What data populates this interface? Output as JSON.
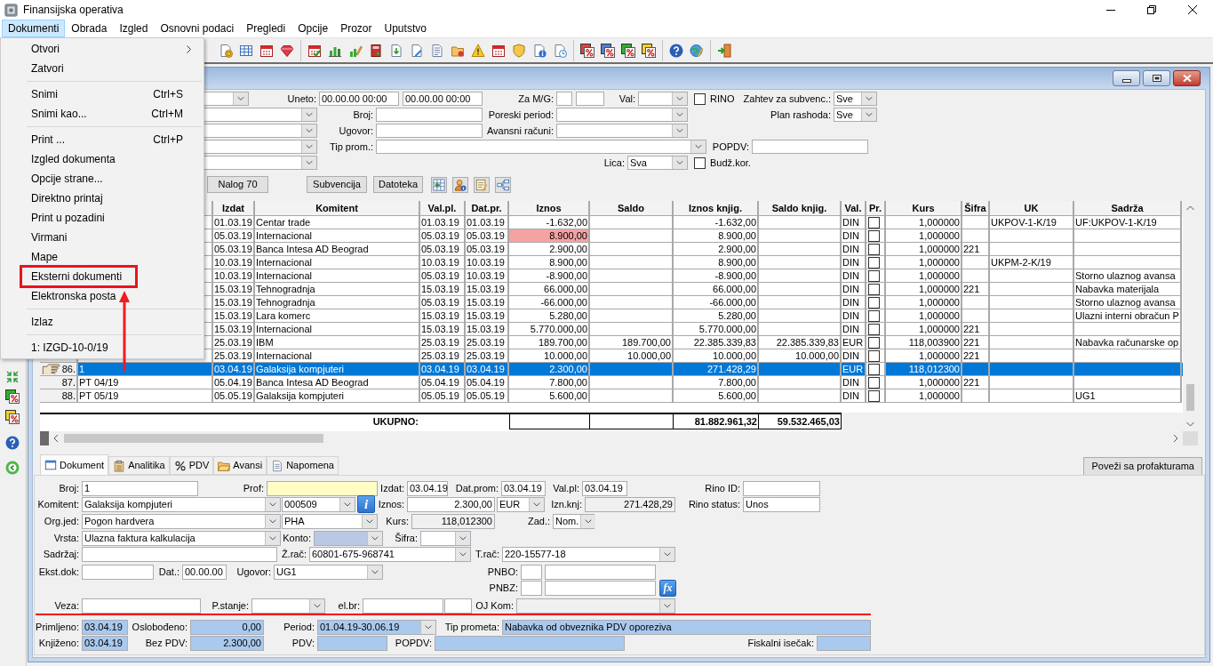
{
  "window": {
    "title": "Finansijska operativa"
  },
  "menu_bar": [
    {
      "label": "Dokumenti",
      "selected": true
    },
    {
      "label": "Obrada",
      "selected": false
    },
    {
      "label": "Izgled",
      "selected": false
    },
    {
      "label": "Osnovni podaci",
      "selected": false
    },
    {
      "label": "Pregledi",
      "selected": false
    },
    {
      "label": "Opcije",
      "selected": false
    },
    {
      "label": "Prozor",
      "selected": false
    },
    {
      "label": "Uputstvo",
      "selected": false
    }
  ],
  "open_menu": [
    {
      "kind": "item",
      "label": "Otvori",
      "submenu": true,
      "callout": false
    },
    {
      "kind": "item",
      "label": "Zatvori",
      "submenu": false,
      "callout": false
    },
    {
      "kind": "separator"
    },
    {
      "kind": "item",
      "label": "Snimi",
      "shortcut": "Ctrl+S",
      "submenu": false,
      "callout": false
    },
    {
      "kind": "item",
      "label": "Snimi kao...",
      "shortcut": "Ctrl+M",
      "submenu": false,
      "callout": false
    },
    {
      "kind": "separator"
    },
    {
      "kind": "item",
      "label": "Print ...",
      "shortcut": "Ctrl+P",
      "submenu": false,
      "callout": false
    },
    {
      "kind": "item",
      "label": "Izgled dokumenta",
      "submenu": false,
      "callout": false
    },
    {
      "kind": "item",
      "label": "Opcije strane...",
      "submenu": false,
      "callout": false
    },
    {
      "kind": "item",
      "label": "Direktno printaj",
      "submenu": false,
      "callout": false
    },
    {
      "kind": "item",
      "label": "Print u pozadini",
      "submenu": false,
      "callout": false
    },
    {
      "kind": "item",
      "label": "Virmani",
      "submenu": false,
      "callout": false
    },
    {
      "kind": "item",
      "label": "Mape",
      "submenu": false,
      "callout": false
    },
    {
      "kind": "item",
      "label": "Eksterni dokumenti",
      "submenu": false,
      "callout": true
    },
    {
      "kind": "item",
      "label": "Elektronska posta",
      "submenu": false,
      "callout": false
    },
    {
      "kind": "separator"
    },
    {
      "kind": "item",
      "label": "Izlaz",
      "submenu": false,
      "callout": false
    },
    {
      "kind": "separator"
    },
    {
      "kind": "item",
      "label": "1: IZGD-10-0/19",
      "submenu": false,
      "callout": false
    }
  ],
  "filters": {
    "lines": [
      {
        "fields": [
          {
            "kind": "combo"
          },
          {
            "kind": "text",
            "label": "Uneto:",
            "value": "00.00.00 00:00"
          },
          {
            "kind": "text",
            "value": "00.00.00 00:00"
          },
          {
            "kind": "text",
            "label": "Za M/G:"
          },
          {
            "kind": "text"
          },
          {
            "kind": "combo",
            "label": "Val:"
          },
          {
            "kind": "check",
            "label": "RINO",
            "checked": false
          },
          {
            "kind": "combo",
            "label": "Zahtev za subvenc.:",
            "value": "Sve"
          }
        ]
      },
      {
        "fields": [
          {
            "kind": "combo"
          },
          {
            "kind": "text",
            "label": "Broj:"
          },
          {
            "kind": "combo",
            "label": "Poreski period:"
          },
          {
            "kind": "combo",
            "label": "Plan rashoda:",
            "value": "Sve"
          }
        ]
      },
      {
        "fields": [
          {
            "kind": "combo"
          },
          {
            "kind": "text",
            "label": "Ugovor:"
          },
          {
            "kind": "combo",
            "label": "Avansni računi:"
          }
        ]
      },
      {
        "fields": [
          {
            "kind": "combo"
          },
          {
            "kind": "combo",
            "label": "Tip prom.:"
          },
          {
            "kind": "text",
            "label": "POPDV:"
          }
        ]
      },
      {
        "fields": [
          {
            "kind": "combo"
          },
          {
            "kind": "combo",
            "label": "Lica:",
            "value": "Sva"
          },
          {
            "kind": "check",
            "label": "Budž.kor.",
            "checked": false
          }
        ]
      }
    ],
    "buttons": [
      "Nalog 70",
      "Subvencija",
      "Datoteka"
    ]
  },
  "table": {
    "columns": {
      "izdat": "Izdat",
      "komitent": "Komitent",
      "val_pl": "Val.pl.",
      "dat_pr": "Dat.pr.",
      "iznos": "Iznos",
      "saldo": "Saldo",
      "iznos_knjig": "Iznos knjig.",
      "saldo_knjig": "Saldo knjig.",
      "val": "Val.",
      "pr": "Pr.",
      "kurs": "Kurs",
      "sifra": "Šifra",
      "uk": "UK",
      "sadrzaj": "Sadrža"
    },
    "rows": [
      {
        "selected": false,
        "izdat": "01.03.19",
        "komitent": "Centar trade",
        "val_pl": "01.03.19",
        "dat_pr": "01.03.19",
        "iznos": "-1.632,00",
        "iznos_alert": false,
        "iznos_knjig": "-1.632,00",
        "val": "DIN",
        "pr_checked": false,
        "kurs": "1,000000",
        "uk": "UKPOV-1-K/19",
        "sadrzaj": "UF:UKPOV-1-K/19"
      },
      {
        "selected": false,
        "izdat": "05.03.19",
        "komitent": "Internacional",
        "val_pl": "05.03.19",
        "dat_pr": "05.03.19",
        "iznos": "8.900,00",
        "iznos_alert": true,
        "iznos_knjig": "8.900,00",
        "val": "DIN",
        "pr_checked": false,
        "kurs": "1,000000"
      },
      {
        "selected": false,
        "izdat": "05.03.19",
        "komitent": "Banca Intesa AD Beograd",
        "val_pl": "05.03.19",
        "dat_pr": "05.03.19",
        "iznos": "2.900,00",
        "iznos_alert": false,
        "iznos_knjig": "2.900,00",
        "val": "DIN",
        "pr_checked": false,
        "kurs": "1,000000",
        "sifra": "221"
      },
      {
        "selected": false,
        "izdat": "10.03.19",
        "komitent": "Internacional",
        "val_pl": "10.03.19",
        "dat_pr": "10.03.19",
        "iznos": "8.900,00",
        "iznos_alert": false,
        "iznos_knjig": "8.900,00",
        "val": "DIN",
        "pr_checked": false,
        "kurs": "1,000000",
        "uk": "UKPM-2-K/19"
      },
      {
        "selected": false,
        "izdat": "10.03.19",
        "komitent": "Internacional",
        "val_pl": "05.03.19",
        "dat_pr": "10.03.19",
        "iznos": "-8.900,00",
        "iznos_alert": false,
        "iznos_knjig": "-8.900,00",
        "val": "DIN",
        "pr_checked": false,
        "kurs": "1,000000",
        "sadrzaj": "Storno ulaznog avansa"
      },
      {
        "selected": false,
        "izdat": "15.03.19",
        "komitent": "Tehnogradnja",
        "val_pl": "15.03.19",
        "dat_pr": "15.03.19",
        "iznos": "66.000,00",
        "iznos_alert": false,
        "iznos_knjig": "66.000,00",
        "val": "DIN",
        "pr_checked": false,
        "kurs": "1,000000",
        "sifra": "221",
        "sadrzaj": "Nabavka materijala"
      },
      {
        "selected": false,
        "izdat": "15.03.19",
        "komitent": "Tehnogradnja",
        "val_pl": "05.03.19",
        "dat_pr": "15.03.19",
        "iznos": "-66.000,00",
        "iznos_alert": false,
        "iznos_knjig": "-66.000,00",
        "val": "DIN",
        "pr_checked": false,
        "kurs": "1,000000",
        "sadrzaj": "Storno ulaznog avansa"
      },
      {
        "selected": false,
        "izdat": "15.03.19",
        "komitent": "Lara komerc",
        "val_pl": "15.03.19",
        "dat_pr": "15.03.19",
        "iznos": "5.280,00",
        "iznos_alert": false,
        "iznos_knjig": "5.280,00",
        "val": "DIN",
        "pr_checked": false,
        "kurs": "1,000000",
        "sadrzaj": "Ulazni interni obračun P"
      },
      {
        "selected": false,
        "izdat": "15.03.19",
        "komitent": "Internacional",
        "val_pl": "15.03.19",
        "dat_pr": "15.03.19",
        "iznos": "5.770.000,00",
        "iznos_alert": false,
        "iznos_knjig": "5.770.000,00",
        "val": "DIN",
        "pr_checked": false,
        "kurs": "1,000000",
        "sifra": "221"
      },
      {
        "selected": false,
        "izdat": "25.03.19",
        "komitent": "IBM",
        "val_pl": "25.03.19",
        "dat_pr": "25.03.19",
        "iznos": "189.700,00",
        "iznos_alert": false,
        "saldo": "189.700,00",
        "iznos_knjig": "22.385.339,83",
        "saldo_knjig": "22.385.339,83",
        "val": "EUR",
        "pr_checked": false,
        "kurs": "118,003900",
        "sifra": "221",
        "sadrzaj": "Nabavka računarske op"
      },
      {
        "selected": false,
        "izdat": "25.03.19",
        "komitent": "Internacional",
        "val_pl": "25.03.19",
        "dat_pr": "25.03.19",
        "iznos": "10.000,00",
        "iznos_alert": false,
        "saldo": "10.000,00",
        "iznos_knjig": "10.000,00",
        "saldo_knjig": "10.000,00",
        "val": "DIN",
        "pr_checked": false,
        "kurs": "1,000000",
        "sifra": "221"
      },
      {
        "selected": true,
        "num": "86.",
        "broj": "1",
        "izdat": "03.04.19",
        "komitent": "Galaksija kompjuteri",
        "val_pl": "03.04.19",
        "dat_pr": "03.04.19",
        "iznos": "2.300,00",
        "iznos_alert": false,
        "iznos_knjig": "271.428,29",
        "val": "EUR",
        "pr_checked": false,
        "kurs": "118,012300"
      },
      {
        "selected": false,
        "num": "87.",
        "broj": "PT 04/19",
        "izdat": "05.04.19",
        "komitent": "Banca Intesa AD Beograd",
        "val_pl": "05.04.19",
        "dat_pr": "05.04.19",
        "iznos": "7.800,00",
        "iznos_alert": false,
        "iznos_knjig": "7.800,00",
        "val": "DIN",
        "pr_checked": false,
        "kurs": "1,000000",
        "sifra": "221"
      },
      {
        "selected": false,
        "num": "88.",
        "broj": "PT 05/19",
        "izdat": "05.05.19",
        "komitent": "Galaksija kompjuteri",
        "val_pl": "05.05.19",
        "dat_pr": "05.05.19",
        "iznos": "5.600,00",
        "iznos_alert": false,
        "iznos_knjig": "5.600,00",
        "val": "DIN",
        "pr_checked": false,
        "kurs": "1,000000",
        "sadrzaj": "UG1"
      }
    ],
    "totals": {
      "label": "UKUPNO:",
      "iznos_knjig": "81.882.961,32",
      "saldo_knjig": "59.532.465,03"
    }
  },
  "detail_tabs": [
    {
      "label": "Dokument",
      "selected": true
    },
    {
      "label": "Analitika",
      "selected": false
    },
    {
      "label": "PDV",
      "selected": false
    },
    {
      "label": "Avansi",
      "selected": false
    },
    {
      "label": "Napomena",
      "selected": false
    }
  ],
  "link_button": "Poveži sa profakturama",
  "form": {
    "lines": [
      {
        "fields": [
          {
            "kind": "text",
            "label": "Broj:",
            "value": "1"
          },
          {
            "kind": "text",
            "label": "Prof:",
            "color": "#fffdc5"
          },
          {
            "kind": "text",
            "label": "Izdat:",
            "value": "03.04.19"
          },
          {
            "kind": "text",
            "label": "Dat.prom:",
            "value": "03.04.19"
          },
          {
            "kind": "text",
            "label": "Val.pl:",
            "value": "03.04.19"
          },
          {
            "kind": "text",
            "label": "Rino ID:"
          }
        ]
      },
      {
        "fields": [
          {
            "kind": "combo",
            "label": "Komitent:",
            "value": "Galaksija kompjuteri"
          },
          {
            "kind": "combo",
            "value": "000509"
          },
          {
            "kind": "info-button",
            "value": "i"
          },
          {
            "kind": "number",
            "label": "Iznos:",
            "value": "2.300,00"
          },
          {
            "kind": "combo",
            "value": "EUR"
          },
          {
            "kind": "number",
            "label": "Izn.knj:",
            "value": "271.428,29",
            "color": "#f0f0f0"
          },
          {
            "kind": "text",
            "label": "Rino status:",
            "value": "Unos"
          }
        ]
      },
      {
        "fields": [
          {
            "kind": "combo",
            "label": "Org.jed:",
            "value": "Pogon hardvera"
          },
          {
            "kind": "combo",
            "value": "PHA"
          },
          {
            "kind": "number",
            "label": "Kurs:",
            "value": "118,012300",
            "color": "#f0f0f0"
          },
          {
            "kind": "combo",
            "label": "Zad.:",
            "value": "Nom."
          }
        ]
      },
      {
        "fields": [
          {
            "kind": "combo",
            "label": "Vrsta:",
            "value": "Ulazna faktura kalkulacija"
          },
          {
            "kind": "combo",
            "label": "Konto:",
            "color": "#b9c8e3"
          },
          {
            "kind": "combo",
            "label": "Šifra:"
          }
        ]
      },
      {
        "fields": [
          {
            "kind": "text",
            "label": "Sadržaj:"
          },
          {
            "kind": "combo",
            "label": "Ž.rač:",
            "value": "60801-675-968741"
          },
          {
            "kind": "combo",
            "label": "T.rač:",
            "value": "220-15577-18"
          }
        ]
      },
      {
        "fields": [
          {
            "kind": "text",
            "label": "Ekst.dok:"
          },
          {
            "kind": "text",
            "label": "Dat.:",
            "value": "00.00.00"
          },
          {
            "kind": "combo",
            "label": "Ugovor:",
            "value": "UG1"
          },
          {
            "kind": "text",
            "label": "PNBO:"
          },
          {
            "kind": "text"
          }
        ]
      },
      {
        "fields": [
          {
            "kind": "text",
            "label": "PNBZ:"
          },
          {
            "kind": "text"
          },
          {
            "kind": "formula-button",
            "value": "fx"
          }
        ]
      },
      {
        "fields": [
          {
            "kind": "text",
            "label": "Veza:"
          },
          {
            "kind": "combo",
            "label": "P.stanje:"
          },
          {
            "kind": "text",
            "label": "el.br:"
          },
          {
            "kind": "text"
          },
          {
            "kind": "combo",
            "label": "OJ Kom:",
            "color": "#f0f0f0"
          }
        ]
      }
    ],
    "summary_lines": [
      {
        "fields": [
          {
            "kind": "text",
            "label": "Primljeno:",
            "value": "03.04.19",
            "color": "#a9c9ef"
          },
          {
            "kind": "number",
            "label": "Oslobođeno:",
            "value": "0,00",
            "color": "#a9c9ef"
          },
          {
            "kind": "combo",
            "label": "Period:",
            "value": "01.04.19-30.06.19",
            "color": "#a9c9ef"
          },
          {
            "kind": "text",
            "label": "Tip prometa:",
            "value": "Nabavka od obveznika PDV oporeziva",
            "color": "#a9c9ef"
          }
        ]
      },
      {
        "fields": [
          {
            "kind": "text",
            "label": "Knjiženo:",
            "value": "03.04.19",
            "color": "#a9c9ef"
          },
          {
            "kind": "number",
            "label": "Bez PDV:",
            "value": "2.300,00",
            "color": "#a9c9ef"
          },
          {
            "kind": "text",
            "label": "PDV:",
            "color": "#a9c9ef"
          },
          {
            "kind": "text",
            "label": "POPDV:",
            "color": "#a9c9ef"
          },
          {
            "kind": "text",
            "label": "Fiskalni isečak:",
            "color": "#a9c9ef"
          }
        ]
      }
    ]
  }
}
